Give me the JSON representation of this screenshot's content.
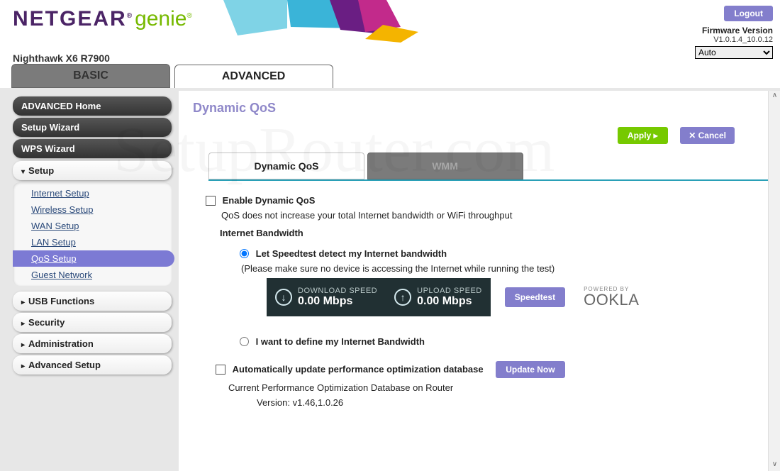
{
  "brand": {
    "netgear": "NETGEAR",
    "genie": "genie",
    "tm": "®"
  },
  "model": "Nighthawk X6 R7900",
  "top": {
    "logout": "Logout",
    "fw_label": "Firmware Version",
    "fw_value": "V1.0.1.4_10.0.12",
    "lang": "Auto"
  },
  "tabs": {
    "basic": "BASIC",
    "advanced": "ADVANCED"
  },
  "sidebar": {
    "advanced_home": "ADVANCED Home",
    "setup_wizard": "Setup Wizard",
    "wps_wizard": "WPS Wizard",
    "setup": "Setup",
    "setup_items": {
      "internet": "Internet Setup",
      "wireless": "Wireless Setup",
      "wan": "WAN Setup",
      "lan": "LAN Setup",
      "qos": "QoS Setup",
      "guest": "Guest Network"
    },
    "usb": "USB Functions",
    "security": "Security",
    "admin": "Administration",
    "adv_setup": "Advanced Setup"
  },
  "page": {
    "title": "Dynamic QoS",
    "apply": "Apply ▸",
    "cancel": "Cancel",
    "x": "✕",
    "subtab_qos": "Dynamic QoS",
    "subtab_wmm": "WMM"
  },
  "form": {
    "enable": "Enable Dynamic QoS",
    "enable_note": "QoS does not increase your total Internet bandwidth or WiFi throughput",
    "bw_header": "Internet Bandwidth",
    "radio_detect": "Let Speedtest detect my Internet bandwidth",
    "detect_note": "(Please make sure no device is accessing the Internet while running the test)",
    "dl_label": "DOWNLOAD SPEED",
    "dl_value": "0.00 Mbps",
    "ul_label": "UPLOAD SPEED",
    "ul_value": "0.00 Mbps",
    "speedtest_btn": "Speedtest",
    "ookla_pw": "POWERED BY",
    "ookla_nm": "OOKLA",
    "radio_manual": "I want to define my Internet Bandwidth",
    "auto_update": "Automatically update performance optimization database",
    "update_now": "Update Now",
    "db_current": "Current Performance Optimization Database on Router",
    "db_version": "Version: v1.46,1.0.26"
  },
  "watermark": "SetupRouter.com"
}
